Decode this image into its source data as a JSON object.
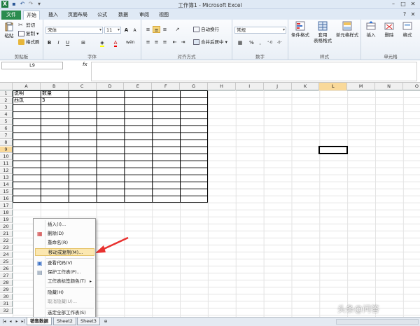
{
  "window": {
    "title": "工作簿1 - Microsoft Excel",
    "qa_icons": [
      "excel-app-icon",
      "save-icon",
      "undo-icon",
      "redo-icon",
      "customize-icon"
    ]
  },
  "tabs": [
    "文件",
    "开始",
    "插入",
    "页面布局",
    "公式",
    "数据",
    "审阅",
    "视图"
  ],
  "active_tab": "开始",
  "ribbon": {
    "clipboard": {
      "paste": "粘贴",
      "cut": "剪切",
      "copy": "复制",
      "format_painter": "格式刷",
      "label": "剪贴板"
    },
    "font": {
      "name": "宋体",
      "size": "11",
      "bold": "B",
      "italic": "I",
      "underline": "U",
      "grow": "A",
      "shrink": "A",
      "wen": "wén",
      "label": "字体"
    },
    "alignment": {
      "wrap": "自动换行",
      "merge": "合并后居中",
      "label": "对齐方式"
    },
    "number": {
      "format": "常规",
      "percent": "%",
      "comma": ",",
      "label": "数字"
    },
    "styles": {
      "conditional": "条件格式",
      "table_1": "套用",
      "table_2": "表格格式",
      "cell_styles": "单元格样式",
      "label": "样式"
    },
    "cells": {
      "insert": "插入",
      "delete": "删除",
      "format": "格式",
      "label": "单元格"
    }
  },
  "formula_bar": {
    "name_box": "L9",
    "fx": "fx",
    "value": ""
  },
  "columns": [
    "A",
    "B",
    "C",
    "D",
    "E",
    "F",
    "G",
    "H",
    "I",
    "J",
    "K",
    "L",
    "M",
    "N",
    "O"
  ],
  "selected_column": "L",
  "rows": [
    "1",
    "2",
    "3",
    "4",
    "5",
    "6",
    "7",
    "8",
    "9",
    "10",
    "11",
    "12",
    "13",
    "14",
    "15",
    "16",
    "17",
    "18",
    "19",
    "20",
    "21",
    "22",
    "23",
    "24",
    "25",
    "26",
    "27",
    "28",
    "29",
    "30",
    "31",
    "32"
  ],
  "selected_row": "9",
  "cells": {
    "A1": "说明",
    "B1": "数量",
    "A2": "西瓜",
    "B2": "3"
  },
  "context_menu": {
    "items": [
      {
        "label": "插入(I)...",
        "icon": "",
        "disabled": false,
        "submenu": false
      },
      {
        "label": "删除(D)",
        "icon": "delete-sheet-icon",
        "disabled": false,
        "submenu": false
      },
      {
        "label": "重命名(R)",
        "icon": "",
        "disabled": false,
        "submenu": false
      },
      {
        "label": "移动或复制(M)...",
        "icon": "",
        "disabled": false,
        "submenu": false,
        "highlighted": true
      },
      {
        "label": "查看代码(V)",
        "icon": "view-code-icon",
        "disabled": false,
        "submenu": false
      },
      {
        "label": "保护工作表(P)...",
        "icon": "protect-sheet-icon",
        "disabled": false,
        "submenu": false
      },
      {
        "label": "工作表标签颜色(T)",
        "icon": "",
        "disabled": false,
        "submenu": true
      },
      {
        "label": "隐藏(H)",
        "icon": "",
        "disabled": false,
        "submenu": false
      },
      {
        "label": "取消隐藏(U)...",
        "icon": "",
        "disabled": true,
        "submenu": false
      },
      {
        "label": "选定全部工作表(S)",
        "icon": "",
        "disabled": false,
        "submenu": false
      }
    ],
    "submenu_arrow": "▸"
  },
  "sheets": [
    "销售数据",
    "Sheet2",
    "Sheet3"
  ],
  "watermark": "头条@问答",
  "colors": {
    "accent": "#2a8c4f",
    "highlight": "#fbe7b0",
    "arrow": "#e8312f"
  }
}
